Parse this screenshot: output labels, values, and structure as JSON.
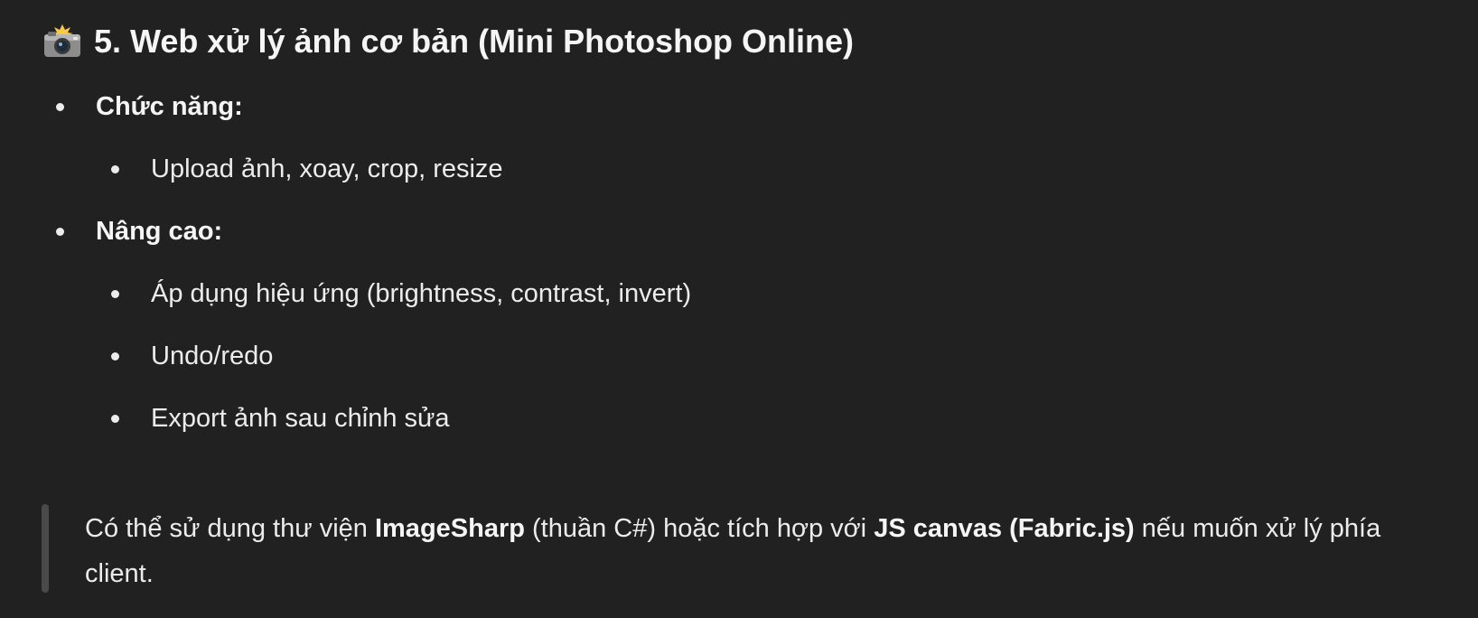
{
  "section": {
    "icon": "camera-flash-icon",
    "title": "5. Web xử lý ảnh cơ bản (Mini Photoshop Online)"
  },
  "features": {
    "label": "Chức năng:",
    "items": [
      "Upload ảnh, xoay, crop, resize"
    ]
  },
  "advanced": {
    "label": "Nâng cao:",
    "items": [
      "Áp dụng hiệu ứng (brightness, contrast, invert)",
      "Undo/redo",
      "Export ảnh sau chỉnh sửa"
    ]
  },
  "note": {
    "part1": "Có thể sử dụng thư viện ",
    "lib1": "ImageSharp",
    "part2": " (thuần C#) hoặc tích hợp với ",
    "lib2": "JS canvas (Fabric.js)",
    "part3": " nếu muốn xử lý phía client."
  }
}
